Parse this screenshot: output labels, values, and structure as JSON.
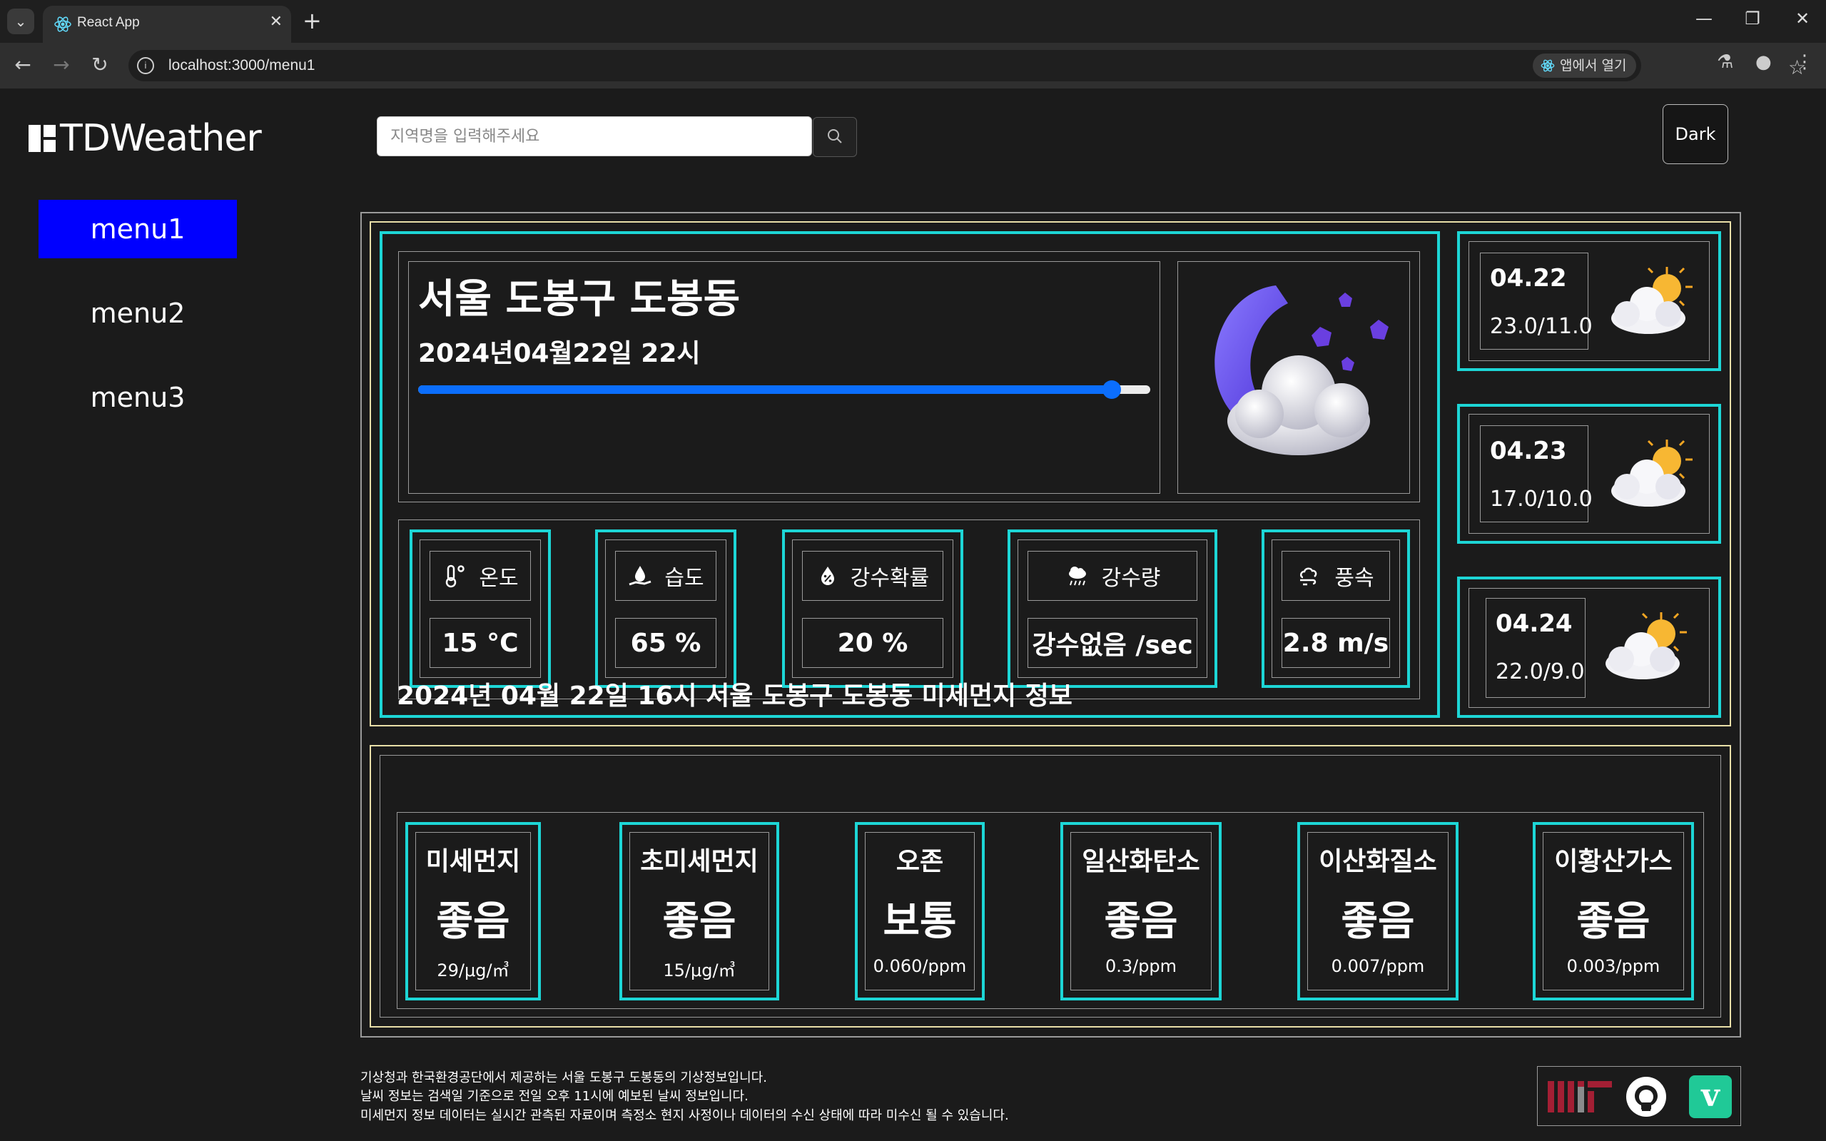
{
  "browser": {
    "tab_title": "React App",
    "tab_close": "✕",
    "new_tab": "+",
    "url": "localhost:3000/menu1",
    "open_in_app": "앱에서 열기",
    "window_controls": {
      "minimize": "—",
      "restore": "❐",
      "close": "✕"
    },
    "nav": {
      "back": "←",
      "forward": "→",
      "reload": "↻"
    }
  },
  "app": {
    "logo_text": "TDWeather",
    "search_placeholder": "지역명을 입력해주세요",
    "theme_button": "Dark",
    "menu": [
      {
        "label": "menu1",
        "active": true
      },
      {
        "label": "menu2",
        "active": false
      },
      {
        "label": "menu3",
        "active": false
      }
    ]
  },
  "current": {
    "location": "서울 도봉구 도봉동",
    "datetime": "2024년04월22일 22시",
    "timeline_progress": 0.947,
    "icon": "moon-cloud-icon",
    "metrics": [
      {
        "label": "온도",
        "value": "15 °C",
        "icon": "thermometer-icon"
      },
      {
        "label": "습도",
        "value": "65 %",
        "icon": "humidity-icon"
      },
      {
        "label": "강수확률",
        "value": "20 %",
        "icon": "rain-probability-icon"
      },
      {
        "label": "강수량",
        "value": "강수없음 /sec",
        "icon": "rain-cloud-icon"
      },
      {
        "label": "풍속",
        "value": "2.8 m/s",
        "icon": "wind-icon"
      }
    ]
  },
  "forecast": [
    {
      "date": "04.22",
      "temp": "23.0/11.0",
      "icon": "sun-cloud-icon"
    },
    {
      "date": "04.23",
      "temp": "17.0/10.0",
      "icon": "sun-cloud-icon"
    },
    {
      "date": "04.24",
      "temp": "22.0/9.0",
      "icon": "sun-cloud-icon"
    }
  ],
  "dust": {
    "title": "2024년 04월 22일 16시 서울 도봉구 도봉동 미세먼지 정보",
    "items": [
      {
        "name": "미세먼지",
        "grade": "좋음",
        "value": "29/μg/㎥"
      },
      {
        "name": "초미세먼지",
        "grade": "좋음",
        "value": "15/μg/㎥"
      },
      {
        "name": "오존",
        "grade": "보통",
        "value": "0.060/ppm"
      },
      {
        "name": "일산화탄소",
        "grade": "좋음",
        "value": "0.3/ppm"
      },
      {
        "name": "이산화질소",
        "grade": "좋음",
        "value": "0.007/ppm"
      },
      {
        "name": "이황산가스",
        "grade": "좋음",
        "value": "0.003/ppm"
      }
    ]
  },
  "footer": {
    "lines": [
      "기상청과 한국환경공단에서 제공하는 서울 도봉구 도봉동의 기상정보입니다.",
      "날씨 정보는 검색일 기준으로 전일 오후 11시에 예보된 날씨 정보입니다.",
      "미세먼지 정보 데이터는 실시간 관측된 자료이며 측정소 현지 사정이나 데이터의 수신 상태에 따라 미수신 될 수 있습니다."
    ],
    "icons": [
      "mit-logo-icon",
      "github-icon",
      "velog-icon"
    ]
  },
  "colors": {
    "accent_menu": "#0000ff",
    "card_border": "#1dd6d6",
    "outer_border": "#e9dfa8",
    "slider": "#0b6efd"
  }
}
